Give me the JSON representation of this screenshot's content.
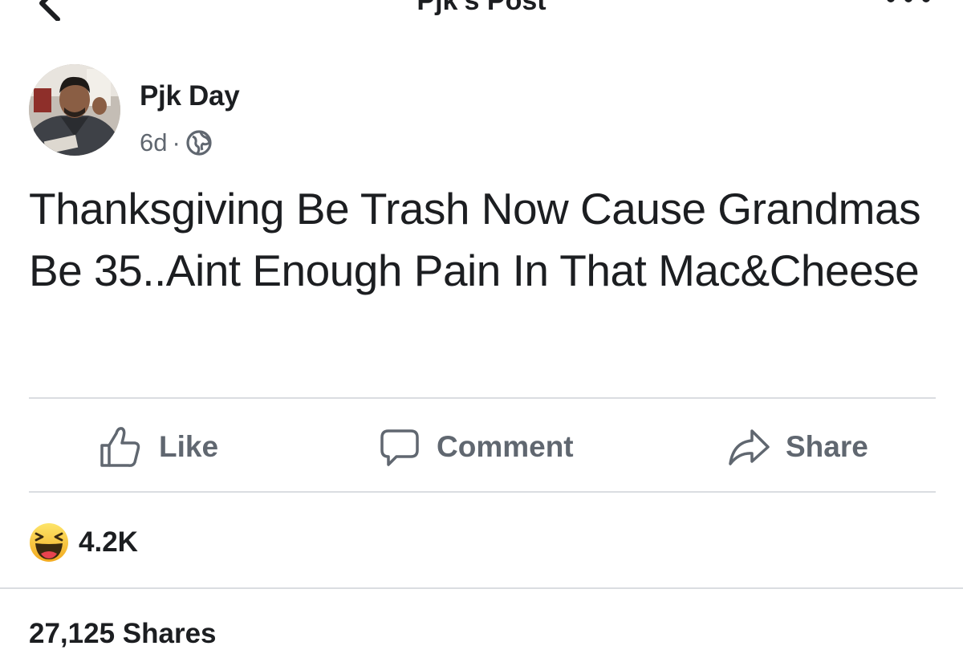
{
  "header": {
    "title": "Pjk's Post",
    "back_icon": "chevron-left-icon",
    "more_icon": "more-horizontal-icon"
  },
  "post": {
    "author": "Pjk Day",
    "time": "6d",
    "separator": "·",
    "audience_icon": "globe-icon",
    "avatar_icon": "profile-photo",
    "text": "Thanksgiving Be Trash Now Cause Grandmas Be 35..Aint Enough Pain In That Mac&Cheese"
  },
  "actions": {
    "like": "Like",
    "comment": "Comment",
    "share": "Share"
  },
  "reactions": {
    "emoji": "haha-reaction-icon",
    "count": "4.2K"
  },
  "shares_count": "27,125 Shares",
  "colors": {
    "text": "#1c1e21",
    "secondary": "#606770",
    "divider": "#dadde1",
    "haha_yellow": "#f7b125"
  }
}
